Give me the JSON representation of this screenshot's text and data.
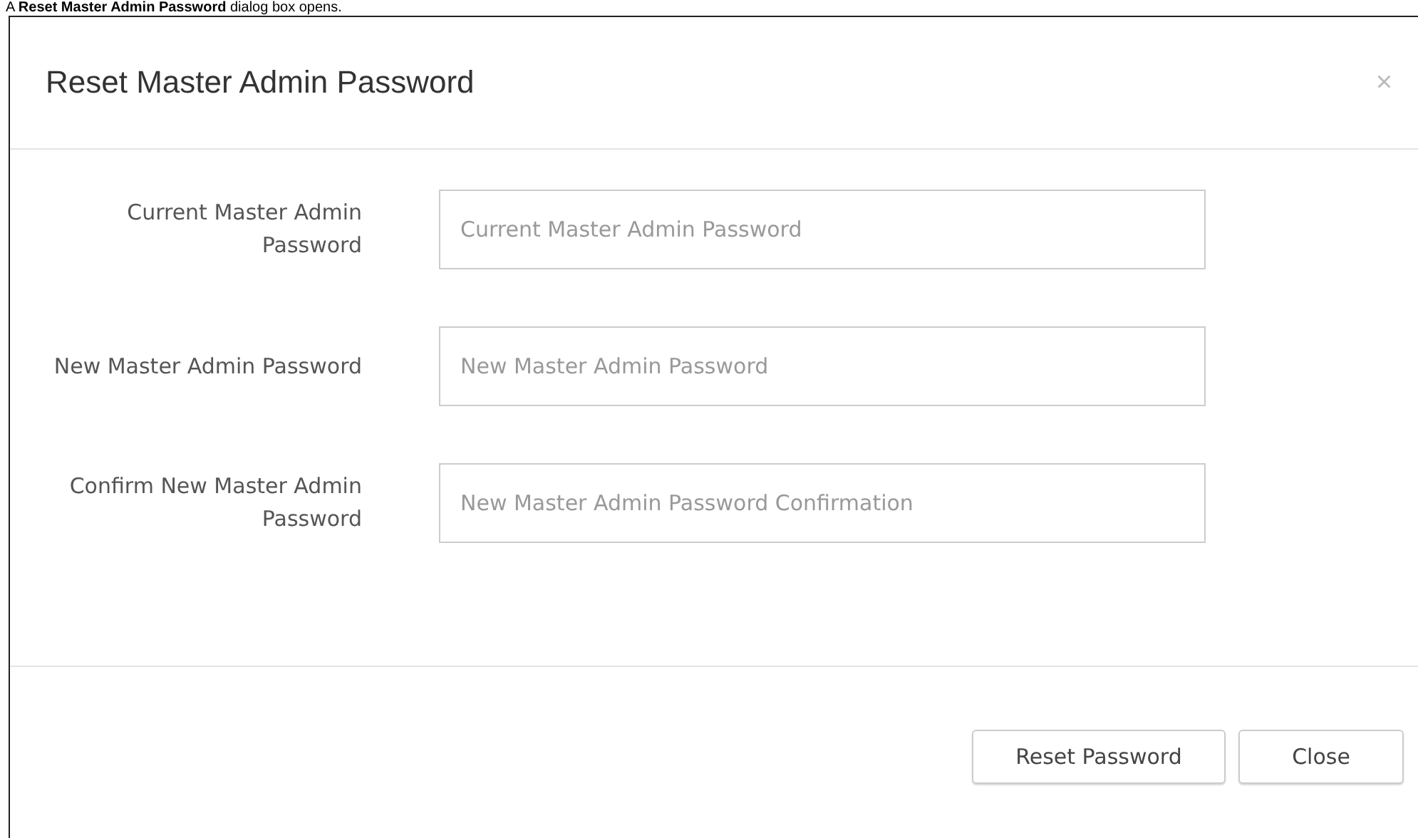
{
  "caption": "A **Reset Master Admin Password** dialog box opens.",
  "dialog": {
    "title": "Reset Master Admin Password",
    "close_icon": "×",
    "fields": [
      {
        "label": "Current Master Admin Password",
        "placeholder": "Current Master Admin Password"
      },
      {
        "label": "New Master Admin Password",
        "placeholder": "New Master Admin Password"
      },
      {
        "label": "Confirm New Master Admin Password",
        "placeholder": "New Master Admin Password Confirmation"
      }
    ],
    "buttons": [
      "Reset Password",
      "Close"
    ]
  }
}
